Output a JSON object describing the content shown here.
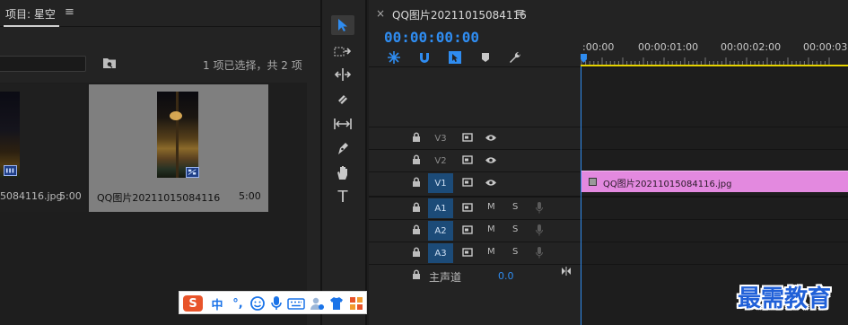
{
  "project_panel": {
    "title": "项目: 星空",
    "menu_icon": "≡",
    "search_placeholder": "",
    "selection_info": "1 项已选择，共 2 项",
    "items": [
      {
        "name": "5084116.jpg",
        "duration": "5:00",
        "selected": false
      },
      {
        "name": "QQ图片20211015084116",
        "duration": "5:00",
        "selected": true
      }
    ]
  },
  "tools": {
    "icons": [
      "selection-tool",
      "track-select-tool",
      "ripple-edit-tool",
      "razor-tool",
      "slip-tool",
      "pen-tool",
      "hand-tool",
      "type-tool"
    ],
    "type_tool_glyph": "T"
  },
  "timeline": {
    "close": "×",
    "title": "QQ图片20211015084116",
    "menu_icon": "≡",
    "timecode": "00:00:00:00",
    "ruler_labels": [
      ":00:00",
      "00:00:01:00",
      "00:00:02:00",
      "00:00:03:0"
    ],
    "video_tracks": [
      {
        "name": "V3",
        "active": false
      },
      {
        "name": "V2",
        "active": false
      },
      {
        "name": "V1",
        "active": true
      }
    ],
    "audio_tracks": [
      {
        "name": "A1",
        "m": "M",
        "s": "S"
      },
      {
        "name": "A2",
        "m": "M",
        "s": "S"
      },
      {
        "name": "A3",
        "m": "M",
        "s": "S"
      }
    ],
    "master": {
      "label": "主声道",
      "value": "0.0"
    },
    "clip": {
      "name": "QQ图片20211015084116.jpg",
      "color": "#e389df"
    }
  },
  "ime_bar": {
    "logo": "S",
    "mode": "中",
    "punct": "°,",
    "colors": {
      "logo_bg": "#e8542a",
      "accent": "#1a73e8"
    }
  },
  "watermark": "最需教育",
  "colors": {
    "accent_blue": "#2f8cf0",
    "clip_pink": "#e389df",
    "work_area": "#e6d300"
  }
}
